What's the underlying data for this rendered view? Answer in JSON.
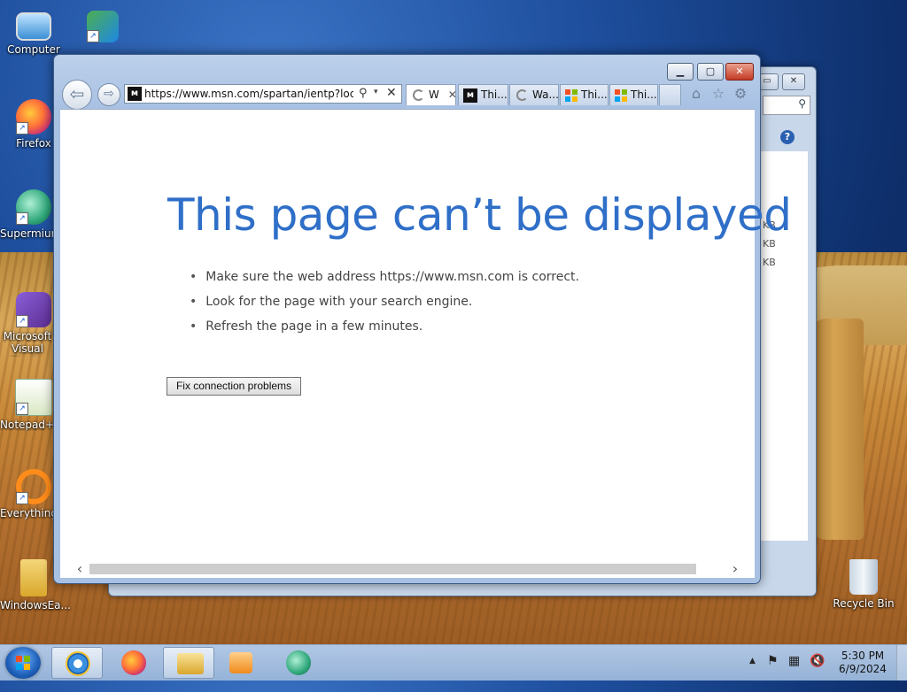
{
  "desktop": {
    "icons": [
      {
        "label": "Computer",
        "icon": "computer-icon"
      },
      {
        "label": "",
        "icon": "network-icon"
      },
      {
        "label": "Firefox",
        "icon": "firefox-icon"
      },
      {
        "label": "Supermium",
        "icon": "supermium-icon"
      },
      {
        "label": "Microsoft Visual Studio",
        "icon": "visual-studio-icon"
      },
      {
        "label": "Notepad++",
        "icon": "notepadpp-icon"
      },
      {
        "label": "Everything",
        "icon": "everything-icon"
      },
      {
        "label": "WindowsEa...",
        "icon": "folder-icon"
      },
      {
        "label": "Recycle Bin",
        "icon": "recycle-bin-icon"
      }
    ]
  },
  "bg_window": {
    "sizes": [
      "KB",
      "KB",
      "KB"
    ]
  },
  "browser": {
    "address_url": "https://www.msn.com/spartan/ientp?locale=",
    "tabs": [
      {
        "label": "W",
        "icon": "loading-spinner-icon",
        "active": true
      },
      {
        "label": "Thi...",
        "icon": "msn-icon",
        "active": false
      },
      {
        "label": "Wa...",
        "icon": "loading-spinner-icon",
        "active": false
      },
      {
        "label": "Thi...",
        "icon": "windows-logo-icon",
        "active": false
      },
      {
        "label": "Thi...",
        "icon": "windows-logo-icon",
        "active": false
      }
    ],
    "error": {
      "title": "This page can’t be displayed",
      "bullets": [
        "Make sure the web address https://www.msn.com is correct.",
        "Look for the page with your search engine.",
        "Refresh the page in a few minutes."
      ],
      "fix_button": "Fix connection problems"
    }
  },
  "taskbar": {
    "clock_time": "5:30 PM",
    "clock_date": "6/9/2024",
    "apps": [
      "internet-explorer-icon",
      "firefox-icon",
      "file-explorer-icon",
      "media-player-icon",
      "supermium-icon"
    ]
  },
  "colors": {
    "error_title": "#2f6fc8",
    "accent": "#1e5fb8"
  }
}
